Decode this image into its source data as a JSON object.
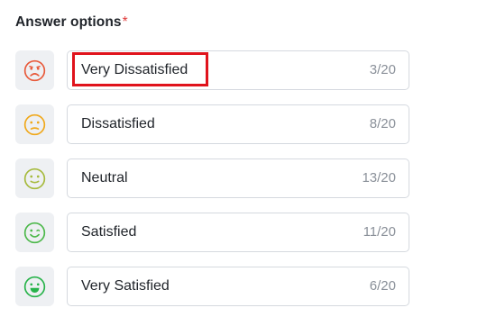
{
  "form": {
    "label": "Answer options",
    "required_mark": "*"
  },
  "options": [
    {
      "text": "Very Dissatisfied",
      "count": "3/20",
      "icon": "very-dissatisfied-face-icon",
      "color": "#e8593a"
    },
    {
      "text": "Dissatisfied",
      "count": "8/20",
      "icon": "dissatisfied-face-icon",
      "color": "#f0a81a"
    },
    {
      "text": "Neutral",
      "count": "13/20",
      "icon": "neutral-face-icon",
      "color": "#a6ba3c"
    },
    {
      "text": "Satisfied",
      "count": "11/20",
      "icon": "satisfied-face-icon",
      "color": "#4cb84a"
    },
    {
      "text": "Very Satisfied",
      "count": "6/20",
      "icon": "very-satisfied-face-icon",
      "color": "#27b34a"
    }
  ],
  "highlight": {
    "color": "#e0131c",
    "target": "Very Dissatisfied"
  }
}
